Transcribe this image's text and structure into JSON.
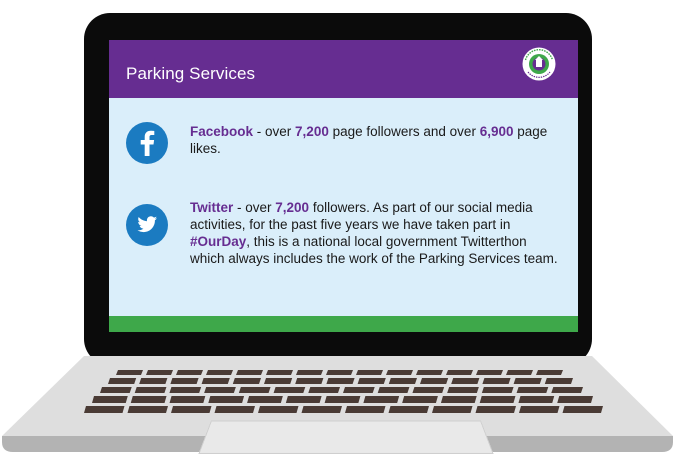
{
  "slide": {
    "title": "Parking Services",
    "logo": {
      "text_top": "CHICHESTER",
      "text_bottom": "District Council",
      "colors": {
        "ring": "#3ea84a",
        "inner": "#662d91"
      }
    },
    "items": [
      {
        "icon": "facebook-icon",
        "name": "Facebook",
        "seg1": " - over ",
        "num1": "7,200",
        "seg2": " page followers and over ",
        "num2": "6,900",
        "seg3": " page likes."
      },
      {
        "icon": "twitter-icon",
        "name": "Twitter",
        "seg1": " - over ",
        "num1": "7,200",
        "seg2": " followers. As part of our social media activities, for the past five years we have taken part in ",
        "tag": "#OurDay",
        "seg3": ", this is a national local government Twitterthon which always includes the work of the Parking Services team."
      }
    ]
  },
  "colors": {
    "header": "#662d91",
    "highlight": "#662d91",
    "screen_bg": "#daeefa",
    "footer_bar": "#3ea84a",
    "icon_blue": "#1b7bc1"
  }
}
